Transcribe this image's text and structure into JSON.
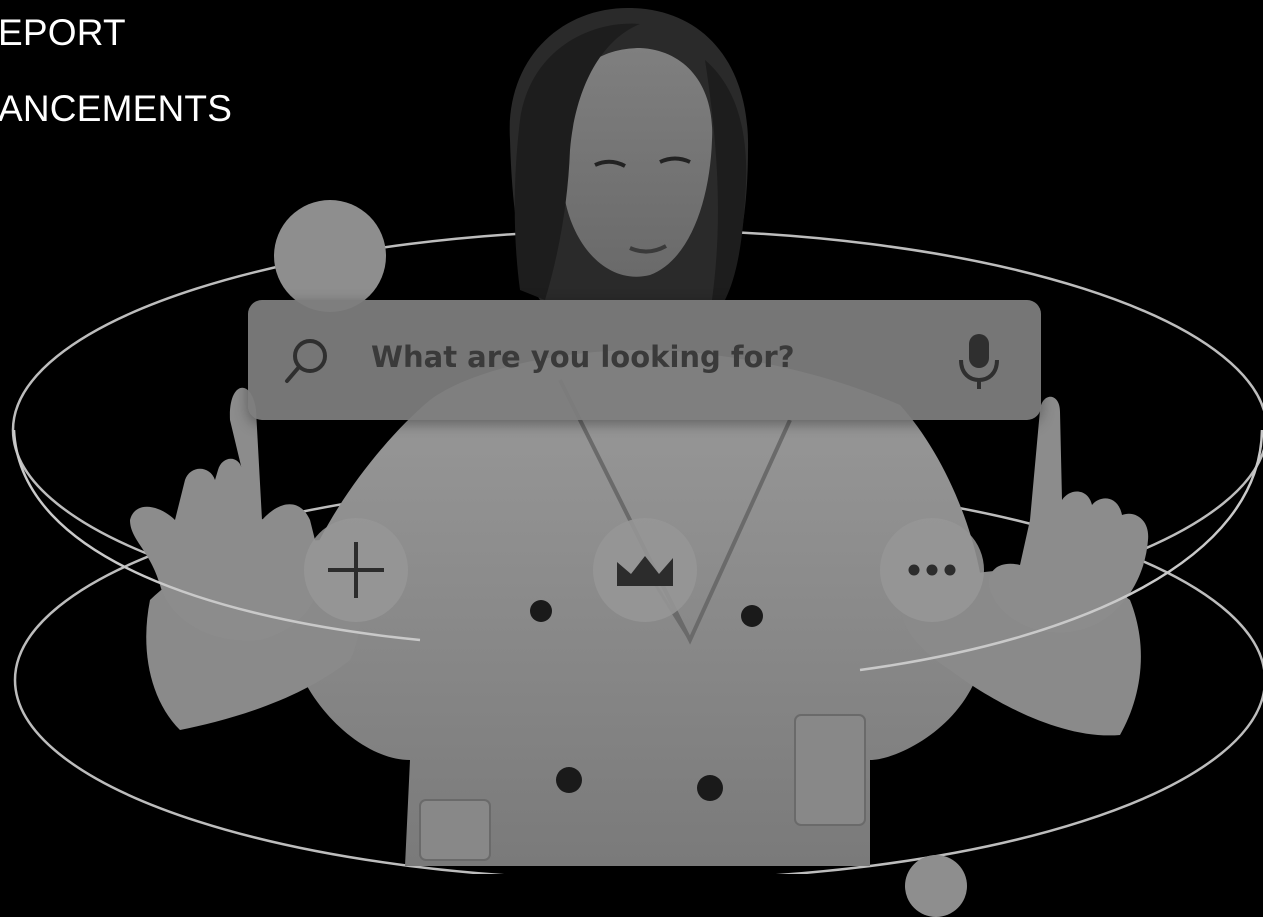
{
  "headings": {
    "line1": "EPORT",
    "line2": "ANCEMENTS"
  },
  "search": {
    "placeholder": "What are you looking for?",
    "left_icon": "search-icon",
    "right_icon": "microphone-icon"
  },
  "action_buttons": [
    {
      "icon": "plus-icon"
    },
    {
      "icon": "crown-icon"
    },
    {
      "icon": "more-horizontal-icon"
    }
  ],
  "colors": {
    "background": "#000000",
    "heading_text": "#ffffff",
    "search_bar": "#7d7d7d",
    "placeholder_text": "#3a3a3a",
    "orbit_stroke": "#bdbdbd"
  }
}
